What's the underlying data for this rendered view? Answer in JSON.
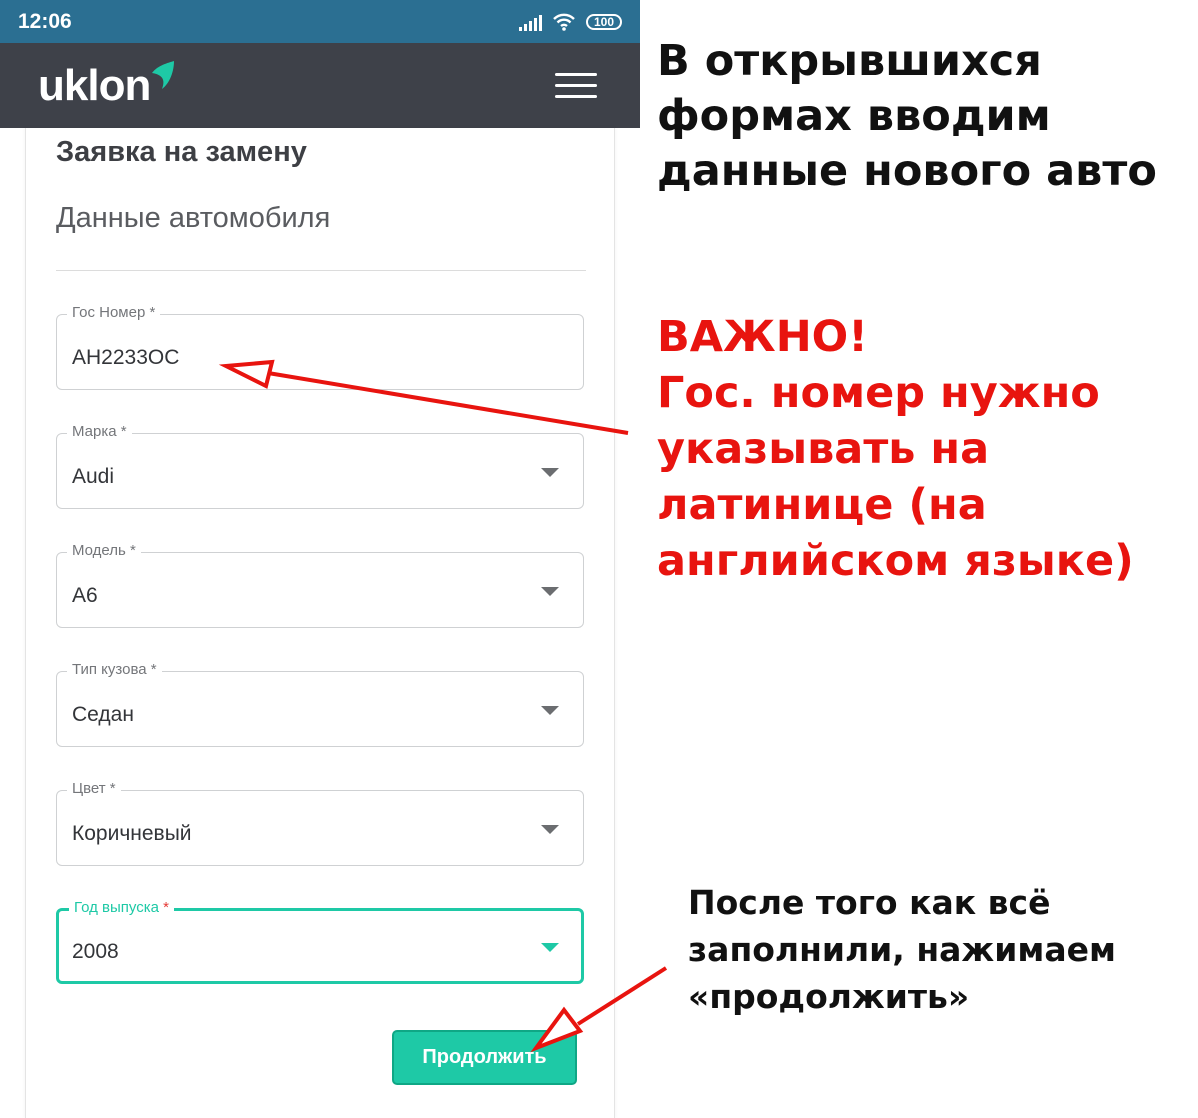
{
  "status_bar": {
    "time": "12:06",
    "battery": "100"
  },
  "app_bar": {
    "logo": "uklon",
    "menu_icon": "hamburger-menu-icon"
  },
  "form": {
    "title": "Заявка на замену",
    "section": "Данные автомобиля",
    "fields": [
      {
        "label": "Гос Номер",
        "required_mark": "*",
        "value": "AH2233OC",
        "type": "text"
      },
      {
        "label": "Марка",
        "required_mark": "*",
        "value": "Audi",
        "type": "select"
      },
      {
        "label": "Модель",
        "required_mark": "*",
        "value": "A6",
        "type": "select"
      },
      {
        "label": "Тип кузова",
        "required_mark": "*",
        "value": "Седан",
        "type": "select"
      },
      {
        "label": "Цвет",
        "required_mark": "*",
        "value": "Коричневый",
        "type": "select"
      },
      {
        "label": "Год выпуска",
        "required_mark": "*",
        "value": "2008",
        "type": "select",
        "focused": true
      }
    ],
    "continue_label": "Продолжить"
  },
  "annotations": {
    "main_lines": [
      "В открывшихся",
      "формах вводим",
      "данные нового авто"
    ],
    "important_lines": [
      "ВАЖНО!",
      "Гос. номер нужно",
      "указывать на",
      "латинице (на",
      "английском языке)"
    ],
    "bottom_lines": [
      "После того как всё",
      "заполнили, нажимаем",
      "«продолжить»"
    ]
  },
  "colors": {
    "status_bar": "#2b6f92",
    "app_bar": "#3e4149",
    "accent": "#1ec9a6",
    "annotation_red": "#e8140f"
  }
}
